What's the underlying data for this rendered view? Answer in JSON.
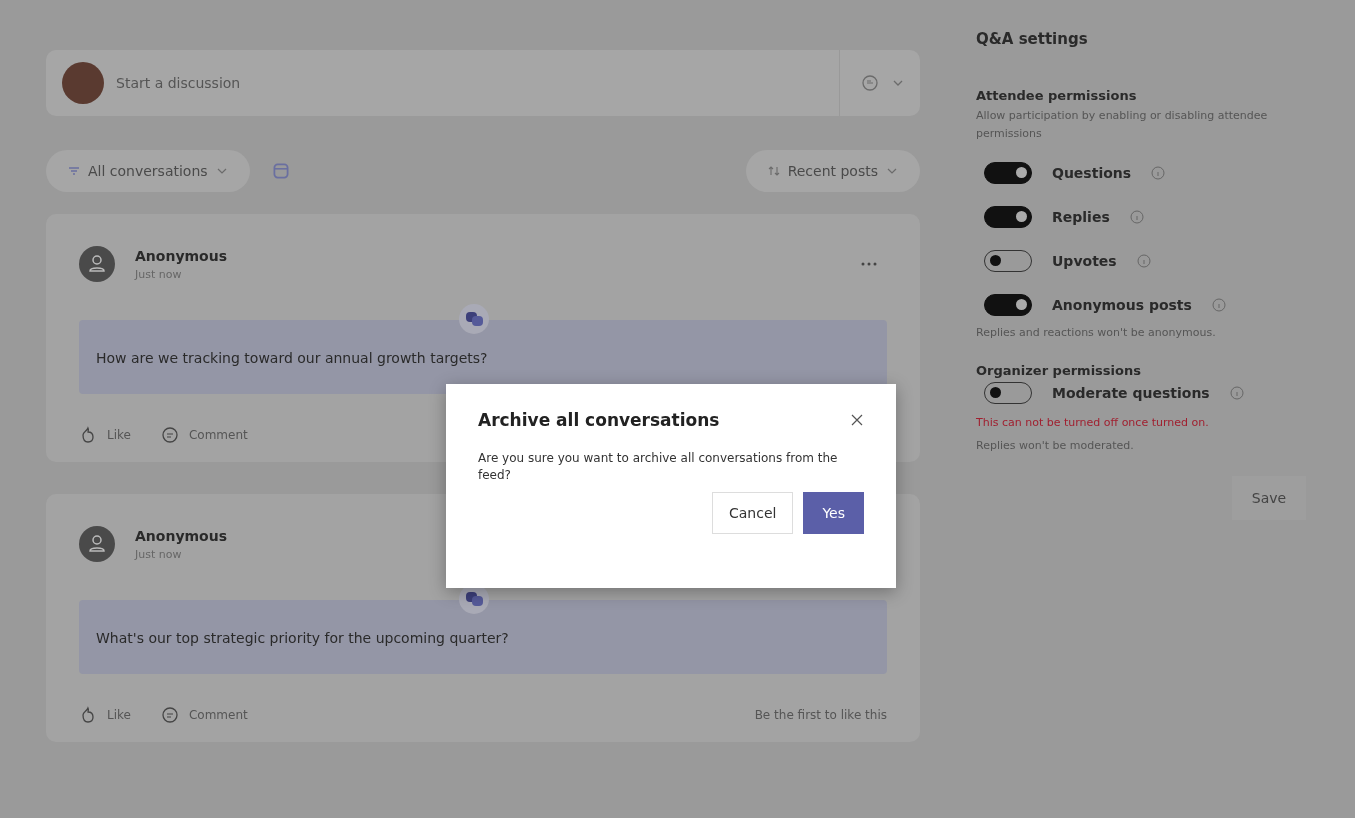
{
  "composer": {
    "placeholder": "Start a discussion"
  },
  "filter": {
    "label": "All conversations"
  },
  "sort": {
    "label": "Recent posts"
  },
  "posts": [
    {
      "author": "Anonymous",
      "time": "Just now",
      "question": "How are we tracking toward our annual growth targets?",
      "like": "Like",
      "comment": "Comment"
    },
    {
      "author": "Anonymous",
      "time": "Just now",
      "question": "What's our top strategic priority for the upcoming quarter?",
      "like": "Like",
      "comment": "Comment",
      "footer": "Be the first to like this"
    }
  ],
  "settings": {
    "title": "Q&A settings",
    "sections": [
      {
        "heading": "Attendee permissions",
        "description": "Allow participation by enabling or disabling attendee permissions",
        "toggles": [
          {
            "label": "Questions",
            "on": true
          },
          {
            "label": "Replies",
            "on": true
          },
          {
            "label": "Upvotes",
            "on": false
          },
          {
            "label": "Anonymous posts",
            "on": true,
            "note": "Replies and reactions won't be anonymous."
          }
        ]
      },
      {
        "heading": "Organizer permissions",
        "toggles": [
          {
            "label": "Moderate questions",
            "on": false,
            "warning": "This can not be turned off once turned on.",
            "note": "Replies won't be moderated."
          }
        ]
      }
    ],
    "save": "Save"
  },
  "dialog": {
    "title": "Archive all conversations",
    "message": "Are you sure you want to archive all conversations from the feed?",
    "buttons": [
      "Cancel",
      "Yes"
    ]
  }
}
